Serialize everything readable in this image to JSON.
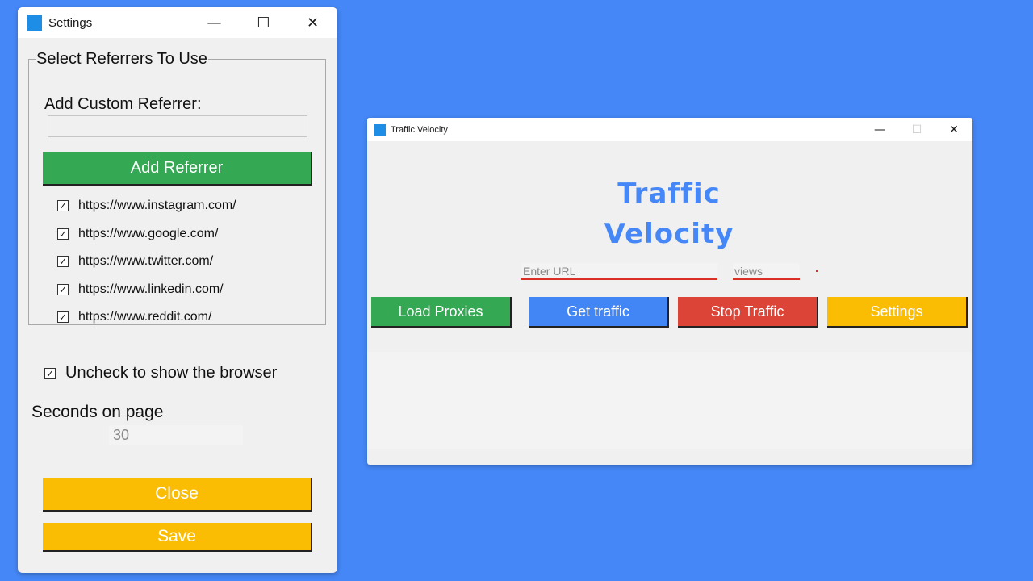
{
  "settings_window": {
    "title": "Settings",
    "caption": {
      "minimize": "—",
      "maximize": "☐",
      "close": "✕"
    },
    "group_title": "Select Referrers To Use",
    "add_label": "Add Custom Referrer:",
    "custom_input_value": "",
    "add_button": "Add Referrer",
    "referrers": [
      {
        "url": "https://www.instagram.com/",
        "checked": true
      },
      {
        "url": "https://www.google.com/",
        "checked": true
      },
      {
        "url": "https://www.twitter.com/",
        "checked": true
      },
      {
        "url": "https://www.linkedin.com/",
        "checked": true
      },
      {
        "url": "https://www.reddit.com/",
        "checked": true
      }
    ],
    "check_mark": "✓",
    "browser_toggle": {
      "label": "Uncheck to show the browser",
      "checked": true
    },
    "seconds_label": "Seconds on page",
    "seconds_value": "30",
    "close_button": "Close",
    "save_button": "Save"
  },
  "tv_window": {
    "title": "Traffic Velocity",
    "caption": {
      "minimize": "—",
      "maximize": "☐",
      "close": "✕"
    },
    "heading": "Traffic Velocity",
    "url_placeholder": "Enter URL",
    "views_placeholder": "views",
    "buttons": {
      "load": "Load Proxies",
      "get": "Get traffic",
      "stop": "Stop Traffic",
      "settings": "Settings"
    }
  },
  "colors": {
    "desktop": "#4587f6",
    "green": "#34a853",
    "blue": "#4285f4",
    "red": "#db4437",
    "yellow": "#fbbc04",
    "app_icon": "#1e8de6"
  },
  "icons": {
    "app": "app-window-icon",
    "minimize": "minimize-icon",
    "maximize": "maximize-icon",
    "close": "close-icon",
    "checkbox": "checkbox-checked-icon"
  }
}
